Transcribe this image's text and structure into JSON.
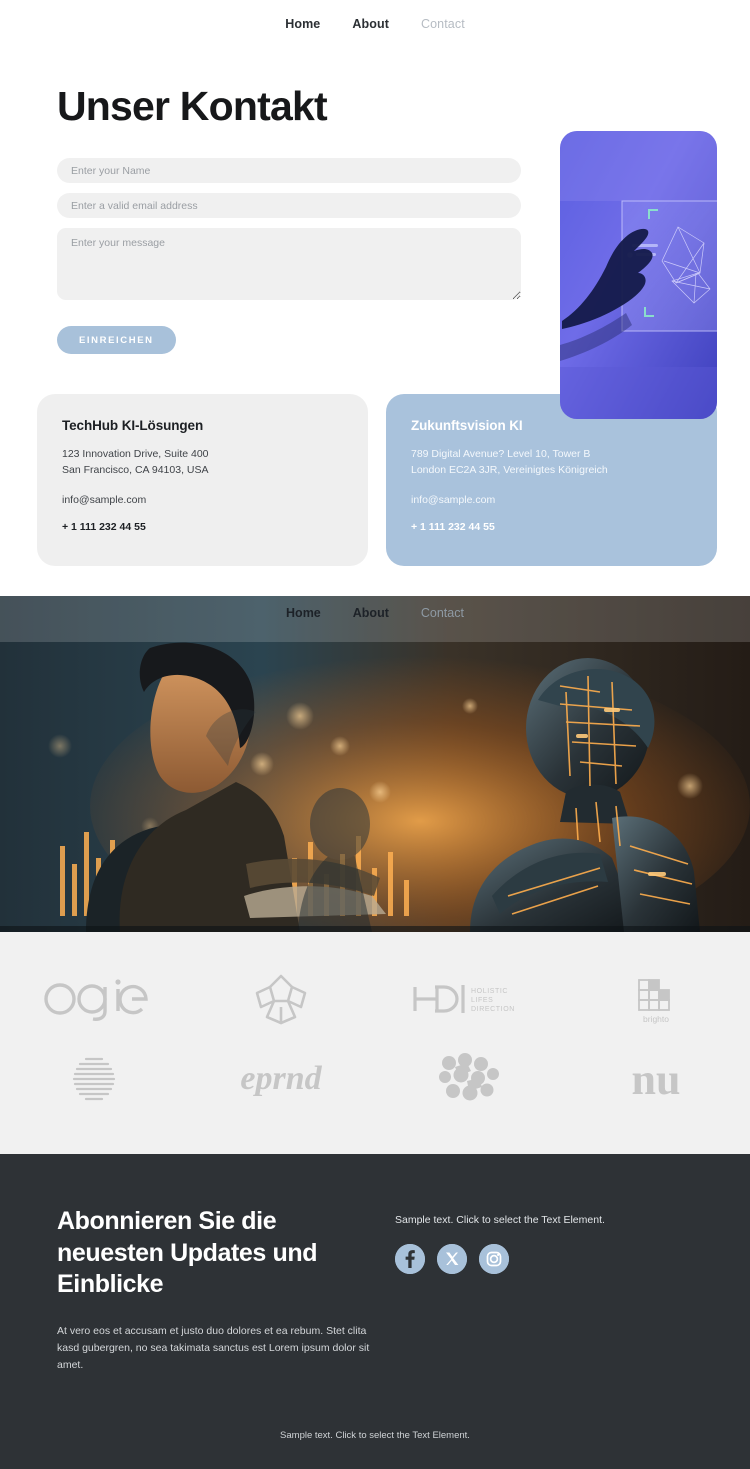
{
  "nav": {
    "items": [
      {
        "label": "Home",
        "muted": false
      },
      {
        "label": "About",
        "muted": false
      },
      {
        "label": "Contact",
        "muted": true
      }
    ]
  },
  "hero": {
    "title": "Unser Kontakt",
    "form": {
      "name_placeholder": "Enter your Name",
      "email_placeholder": "Enter a valid email address",
      "message_placeholder": "Enter your message",
      "submit_label": "EINREICHEN",
      "name_value": "",
      "email_value": "",
      "message_value": ""
    },
    "image_alt": "hand-touching-holographic-screen"
  },
  "cards": [
    {
      "title": "TechHub KI-Lösungen",
      "address_line1": "123 Innovation Drive, Suite 400",
      "address_line2": "San Francisco, CA 94103, USA",
      "email": "info@sample.com",
      "phone": "+ 1 111 232 44 55"
    },
    {
      "title": "Zukunftsvision KI",
      "address_line1": "789 Digital Avenue? Level 10, Tower B",
      "address_line2": "London EC2A 3JR, Vereinigtes Königreich",
      "email": "info@sample.com",
      "phone": "+ 1 111 232 44 55"
    }
  ],
  "banner": {
    "nav": [
      {
        "label": "Home",
        "muted": false
      },
      {
        "label": "About",
        "muted": false
      },
      {
        "label": "Contact",
        "muted": true
      }
    ],
    "image_alt": "woman-typing-next-to-glowing-robot"
  },
  "logos": [
    {
      "name": "ogie",
      "text": "ogie"
    },
    {
      "name": "flower-star",
      "text": ""
    },
    {
      "name": "holistic-lifes-direction",
      "text": "HD",
      "sub1": "HOLISTIC",
      "sub2": "LIFES",
      "sub3": "DIRECTION"
    },
    {
      "name": "brighto",
      "text": "brighto"
    },
    {
      "name": "striped-sphere",
      "text": ""
    },
    {
      "name": "eprd-script",
      "text": "eprnd"
    },
    {
      "name": "dots-pattern",
      "text": ""
    },
    {
      "name": "nu",
      "text": "nu"
    }
  ],
  "footer": {
    "heading": "Abonnieren Sie die neuesten Updates und Einblicke",
    "body": "At vero eos et accusam et justo duo dolores et ea rebum. Stet clita kasd gubergren, no sea takimata sanctus est Lorem ipsum dolor sit amet.",
    "right_text": "Sample text. Click to select the Text Element.",
    "socials": [
      {
        "name": "facebook",
        "label": "f"
      },
      {
        "name": "x-twitter",
        "label": "X"
      },
      {
        "name": "instagram",
        "label": ""
      }
    ],
    "bottom_text": "Sample text. Click to select the Text Element."
  },
  "colors": {
    "accent_blue": "#a8c1da",
    "card_blue": "#a9c2dc",
    "card_grey": "#efefef",
    "footer_dark": "#2e3236",
    "logo_grey": "#c8c8c8"
  }
}
